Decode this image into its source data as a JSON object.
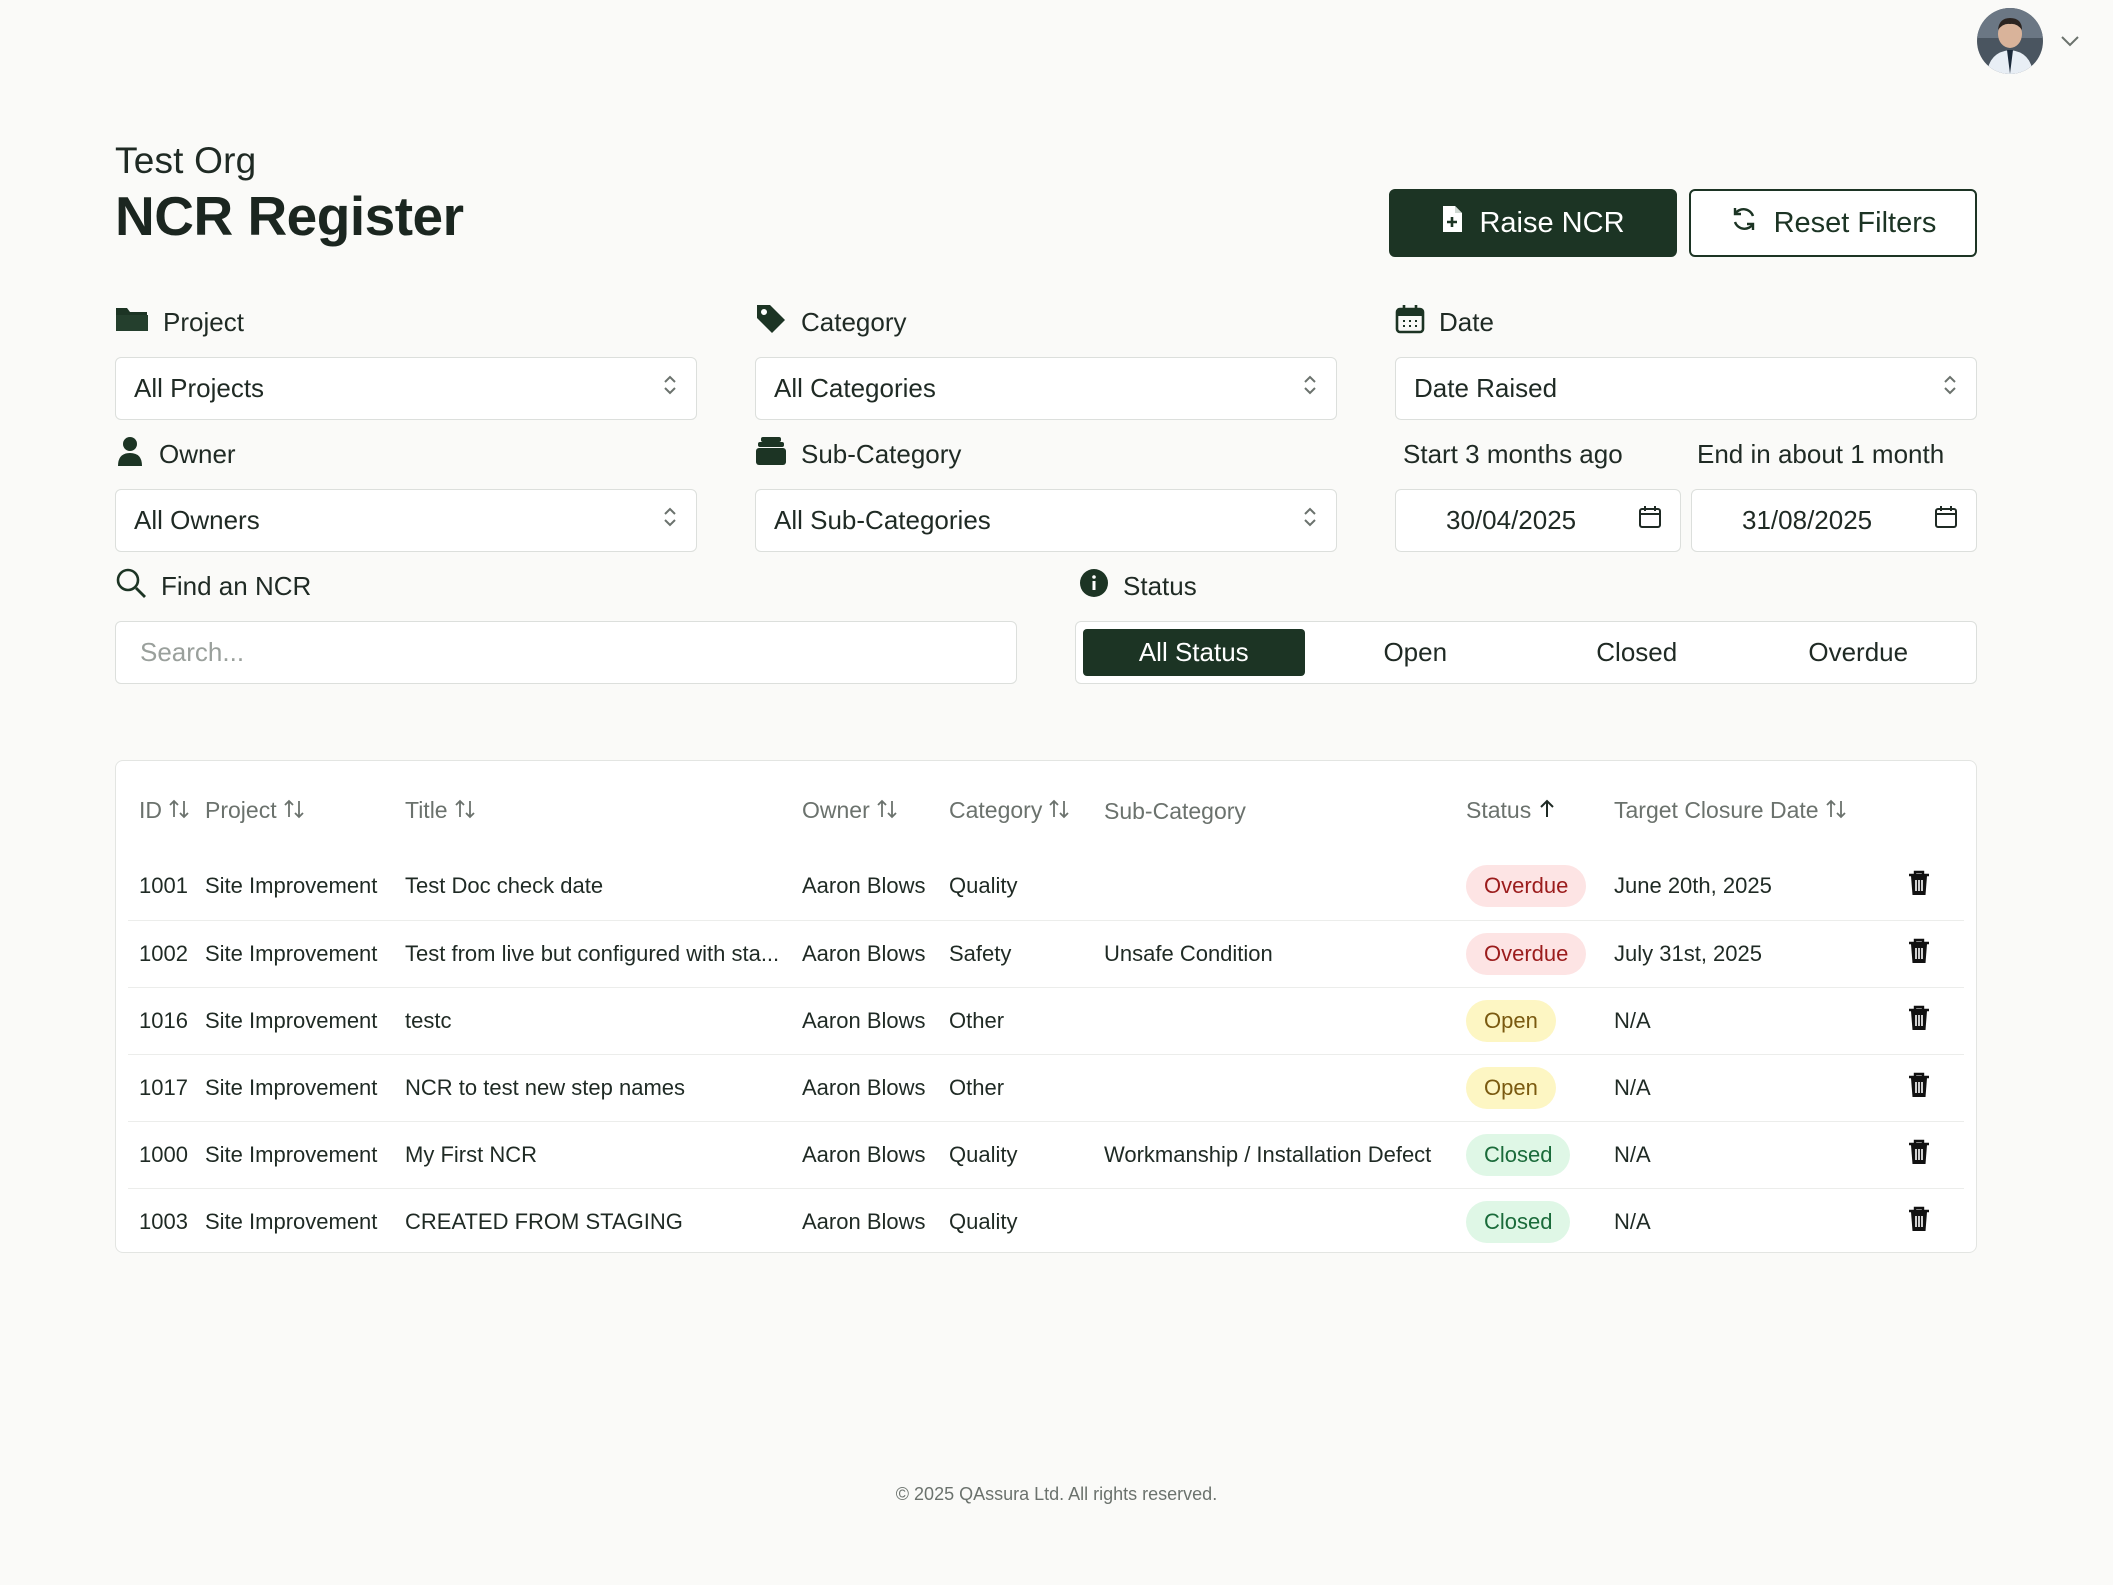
{
  "user": {
    "avatar_icon": "user-avatar",
    "menu_icon": "chevron-down-icon"
  },
  "header": {
    "org": "Test Org",
    "title": "NCR Register",
    "raise_label": "Raise NCR",
    "reset_label": "Reset Filters"
  },
  "filters": {
    "project": {
      "label": "Project",
      "value": "All Projects"
    },
    "category": {
      "label": "Category",
      "value": "All Categories"
    },
    "date": {
      "label": "Date",
      "value": "Date Raised"
    },
    "owner": {
      "label": "Owner",
      "value": "All Owners"
    },
    "subcategory": {
      "label": "Sub-Category",
      "value": "All Sub-Categories"
    },
    "start": {
      "label": "Start 3 months ago",
      "value": "30/04/2025"
    },
    "end": {
      "label": "End in about 1 month",
      "value": "31/08/2025"
    },
    "search": {
      "label": "Find an NCR",
      "placeholder": "Search..."
    },
    "status": {
      "label": "Status",
      "options": [
        "All Status",
        "Open",
        "Closed",
        "Overdue"
      ],
      "selected": "All Status"
    }
  },
  "table": {
    "columns": [
      "ID",
      "Project",
      "Title",
      "Owner",
      "Category",
      "Sub-Category",
      "Status",
      "Target Closure Date"
    ],
    "rows": [
      {
        "id": "1001",
        "project": "Site Improvement",
        "title": "Test Doc check date",
        "owner": "Aaron Blows",
        "category": "Quality",
        "subcategory": "",
        "status": "Overdue",
        "target": "June 20th, 2025"
      },
      {
        "id": "1002",
        "project": "Site Improvement",
        "title": "Test from live but configured with sta...",
        "owner": "Aaron Blows",
        "category": "Safety",
        "subcategory": "Unsafe Condition",
        "status": "Overdue",
        "target": "July 31st, 2025"
      },
      {
        "id": "1016",
        "project": "Site Improvement",
        "title": "testc",
        "owner": "Aaron Blows",
        "category": "Other",
        "subcategory": "",
        "status": "Open",
        "target": "N/A"
      },
      {
        "id": "1017",
        "project": "Site Improvement",
        "title": "NCR to test new step names",
        "owner": "Aaron Blows",
        "category": "Other",
        "subcategory": "",
        "status": "Open",
        "target": "N/A"
      },
      {
        "id": "1000",
        "project": "Site Improvement",
        "title": "My First NCR",
        "owner": "Aaron Blows",
        "category": "Quality",
        "subcategory": "Workmanship / Installation Defect",
        "status": "Closed",
        "target": "N/A"
      },
      {
        "id": "1003",
        "project": "Site Improvement",
        "title": "CREATED FROM STAGING",
        "owner": "Aaron Blows",
        "category": "Quality",
        "subcategory": "",
        "status": "Closed",
        "target": "N/A"
      }
    ]
  },
  "footer": "© 2025 QAssura Ltd. All rights reserved.",
  "colors": {
    "primary": "#1c3424",
    "overdue_bg": "#fde4e4",
    "open_bg": "#fdf6c3",
    "closed_bg": "#dff7e6"
  }
}
